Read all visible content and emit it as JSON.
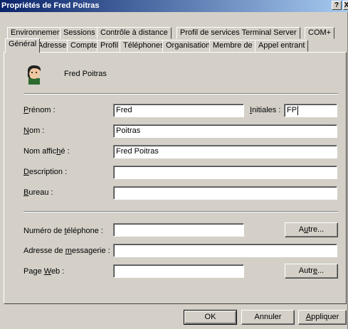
{
  "title": "Propriétés de Fred Poitras",
  "titlebar_buttons": {
    "help": "?",
    "close": "X"
  },
  "tabs_row1": [
    "Environnement",
    "Sessions",
    "Contrôle à distance",
    "Profil de services Terminal Server",
    "COM+"
  ],
  "tabs_row2": [
    "Général",
    "Adresse",
    "Compte",
    "Profil",
    "Téléphones",
    "Organisation",
    "Membre de",
    "Appel entrant"
  ],
  "selected_tab": "Général",
  "user": {
    "icon": "user-icon",
    "display_name": "Fred Poitras"
  },
  "fields": {
    "prenom": {
      "pre": "",
      "key": "P",
      "post": "rénom :",
      "value": "Fred"
    },
    "initiales": {
      "pre": "",
      "key": "I",
      "post": "nitiales :",
      "value": "FP"
    },
    "nom": {
      "pre": "",
      "key": "N",
      "post": "om :",
      "value": "Poitras"
    },
    "nom_affiche": {
      "pre": "Nom affic",
      "key": "h",
      "post": "é :",
      "value": "Fred Poitras"
    },
    "description": {
      "pre": "",
      "key": "D",
      "post": "escription :",
      "value": ""
    },
    "bureau": {
      "pre": "",
      "key": "B",
      "post": "ureau :",
      "value": ""
    },
    "telephone": {
      "pre": "Numéro de ",
      "key": "t",
      "post": "éléphone :",
      "value": ""
    },
    "messagerie": {
      "pre": "Adresse de ",
      "key": "m",
      "post": "essagerie :",
      "value": ""
    },
    "page_web": {
      "pre": "Page ",
      "key": "W",
      "post": "eb :",
      "value": ""
    }
  },
  "autre_tel": {
    "pre": "A",
    "key": "u",
    "post": "tre..."
  },
  "autre_web": {
    "pre": "Autr",
    "key": "e",
    "post": "..."
  },
  "buttons": {
    "ok": "OK",
    "annuler": "Annuler",
    "appliquer_key": "A",
    "appliquer_rest": "ppliquer"
  }
}
